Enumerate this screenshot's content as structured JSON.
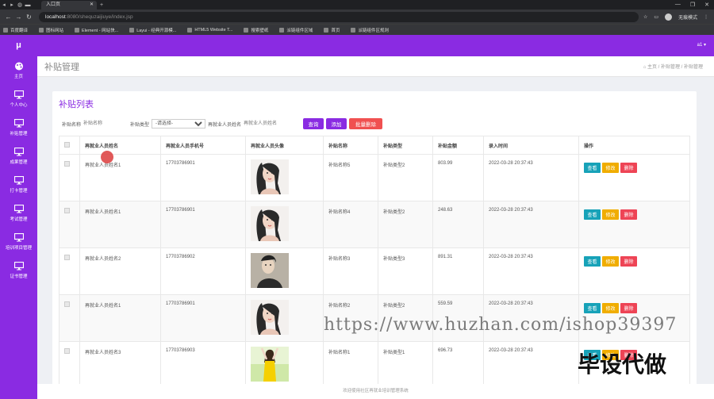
{
  "browser": {
    "tab_title": "入口页",
    "url_host": "localhost",
    "url_path": ":8080/shequzaijiuye/index.jsp",
    "profile_label": "无痕模式",
    "bookmarks": [
      "百度翻译",
      "图标网站",
      "Element - 网站快...",
      "Layui - 经典开源模...",
      "HTML5 Website T...",
      "搜索壁纸",
      "派链组件区域",
      "首页",
      "派链组件区规则"
    ]
  },
  "app": {
    "logo": "μ",
    "user": "a1 ▾",
    "nav": [
      {
        "label": "主页",
        "icon": "palette-icon"
      },
      {
        "label": "个人中心",
        "icon": "monitor-icon"
      },
      {
        "label": "补贴管理",
        "icon": "monitor-icon"
      },
      {
        "label": "成果管理",
        "icon": "monitor-icon"
      },
      {
        "label": "打卡管理",
        "icon": "monitor-icon"
      },
      {
        "label": "考试管理",
        "icon": "monitor-icon"
      },
      {
        "label": "培训项目管理",
        "icon": "monitor-icon"
      },
      {
        "label": "证书管理",
        "icon": "monitor-icon"
      }
    ]
  },
  "page": {
    "title": "补贴管理",
    "breadcrumb": "⌂ 主页 / 补贴管理 / 补贴管理",
    "card_title": "补贴列表"
  },
  "search": {
    "name_label": "补贴名称",
    "name_placeholder": "补贴名称",
    "type_label": "补贴类型",
    "type_selected": "-请选择-",
    "person_label": "再就业人员姓名",
    "person_placeholder": "再就业人员姓名",
    "query_btn": "查询",
    "add_btn": "添加",
    "batch_delete_btn": "批量删除"
  },
  "table": {
    "headers": [
      "再就业人员姓名",
      "再就业人员手机号",
      "再就业人员头像",
      "补贴名称",
      "补贴类型",
      "补贴金额",
      "录入时间",
      "操作"
    ],
    "rows": [
      {
        "name": "再就业人员姓名1",
        "phone": "17703786901",
        "subsidy": "补贴名称5",
        "type": "补贴类型2",
        "amount": "803.99",
        "time": "2022-03-28 20:37:43"
      },
      {
        "name": "再就业人员姓名1",
        "phone": "17703786901",
        "subsidy": "补贴名称4",
        "type": "补贴类型2",
        "amount": "248.63",
        "time": "2022-03-28 20:37:43"
      },
      {
        "name": "再就业人员姓名2",
        "phone": "17703786902",
        "subsidy": "补贴名称3",
        "type": "补贴类型3",
        "amount": "891.31",
        "time": "2022-03-28 20:37:43"
      },
      {
        "name": "再就业人员姓名1",
        "phone": "17703786901",
        "subsidy": "补贴名称2",
        "type": "补贴类型2",
        "amount": "559.59",
        "time": "2022-03-28 20:37:43"
      },
      {
        "name": "再就业人员姓名3",
        "phone": "17703786903",
        "subsidy": "补贴名称1",
        "type": "补贴类型1",
        "amount": "696.73",
        "time": "2022-03-28 20:37:43"
      }
    ],
    "op_view": "查看",
    "op_edit": "修改",
    "op_delete": "删除"
  },
  "footer": "欢迎使用社区再就业培训管理系统",
  "watermark": "https://www.huzhan.com/ishop39397",
  "watermark2": "毕设代做",
  "colors": {
    "brand": "#8a2be2",
    "view": "#17a2b8",
    "edit": "#f0ad00",
    "delete": "#ee4455",
    "batch_delete": "#f05050"
  }
}
